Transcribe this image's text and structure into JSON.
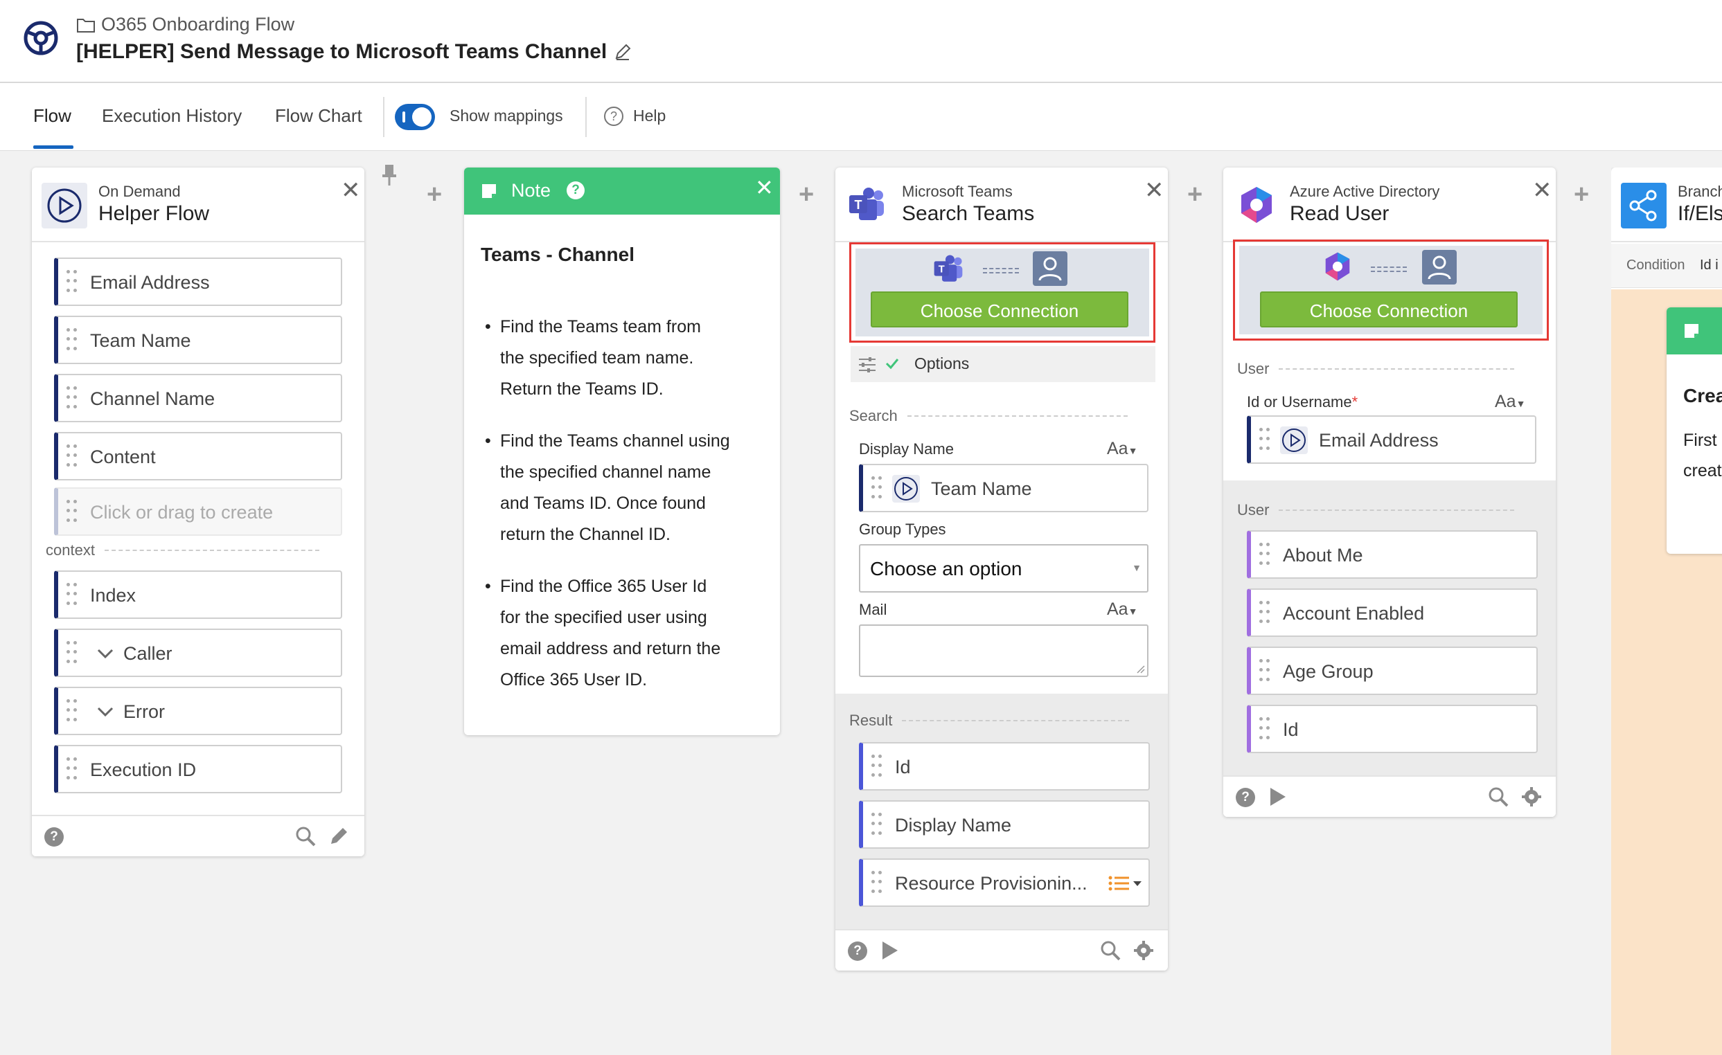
{
  "header": {
    "breadcrumb": "O365 Onboarding Flow",
    "title": "[HELPER] Send Message to Microsoft Teams Channel"
  },
  "tabs": {
    "flow": "Flow",
    "execution_history": "Execution History",
    "flow_chart": "Flow Chart",
    "show_mappings": "Show mappings",
    "show_mappings_on": true,
    "help": "Help"
  },
  "on_demand": {
    "subtitle": "On Demand",
    "title": "Helper Flow",
    "fields": [
      "Email Address",
      "Team Name",
      "Channel Name",
      "Content"
    ],
    "create_placeholder": "Click or drag to create",
    "context_label": "context",
    "context_fields": [
      "Index",
      "Caller",
      "Error",
      "Execution ID"
    ]
  },
  "note": {
    "header": "Note",
    "heading": "Teams - Channel",
    "bullets": [
      [
        "Find the Teams team from",
        "the specified team name.",
        "Return the Teams ID."
      ],
      [
        "Find the Teams channel using",
        "the specified channel name",
        "and Teams ID. Once found",
        "return the Channel ID."
      ],
      [
        "Find the Office 365 User Id",
        "for the specified user using",
        "email address and return the",
        "Office 365 User ID."
      ]
    ]
  },
  "teams": {
    "subtitle": "Microsoft Teams",
    "title": "Search Teams",
    "choose_connection": "Choose Connection",
    "options": "Options",
    "search_label": "Search",
    "display_name_label": "Display Name",
    "display_name_value": "Team Name",
    "aa": "Aa",
    "group_types_label": "Group Types",
    "group_types_value": "Choose an option",
    "mail_label": "Mail",
    "result_label": "Result",
    "results": [
      "Id",
      "Display Name",
      "Resource Provisionin..."
    ]
  },
  "azure": {
    "subtitle": "Azure Active Directory",
    "title": "Read User",
    "choose_connection": "Choose Connection",
    "user_label": "User",
    "id_label": "Id or Username",
    "required_mark": "*",
    "aa": "Aa",
    "id_value": "Email Address",
    "user_label_2": "User",
    "fields": [
      "About Me",
      "Account Enabled",
      "Age Group",
      "Id"
    ]
  },
  "branch": {
    "subtitle": "Branch",
    "title": "If/Else",
    "condition": "Condition",
    "condition_value": "Id i",
    "partial_text": [
      "Crea",
      "First",
      "creat"
    ]
  },
  "colors": {
    "accent": "#1565c0",
    "note_green": "#40c47a",
    "connect_green": "#7cba3d",
    "highlight_red": "#e53935",
    "branch_peach": "#fbe3c8"
  }
}
